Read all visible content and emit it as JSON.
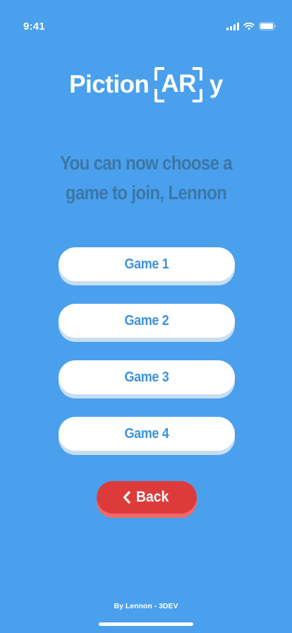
{
  "status_bar": {
    "time": "9:41"
  },
  "logo": {
    "prefix": "Piction",
    "boxed": "AR",
    "suffix": "y"
  },
  "headline": {
    "line1": "You can now choose a",
    "line2": "game to join, Lennon"
  },
  "games": [
    {
      "label": "Game 1"
    },
    {
      "label": "Game 2"
    },
    {
      "label": "Game 3"
    },
    {
      "label": "Game 4"
    }
  ],
  "back_button": {
    "label": "Back",
    "icon": "chevron-left-icon"
  },
  "footer": {
    "credit": "By Lennon - 3DEV"
  },
  "colors": {
    "background": "#4aa0ec",
    "headline": "#3b77a8",
    "button_bg": "#ffffff",
    "button_text": "#3f93dd",
    "back_bg": "#dd3b3b"
  }
}
